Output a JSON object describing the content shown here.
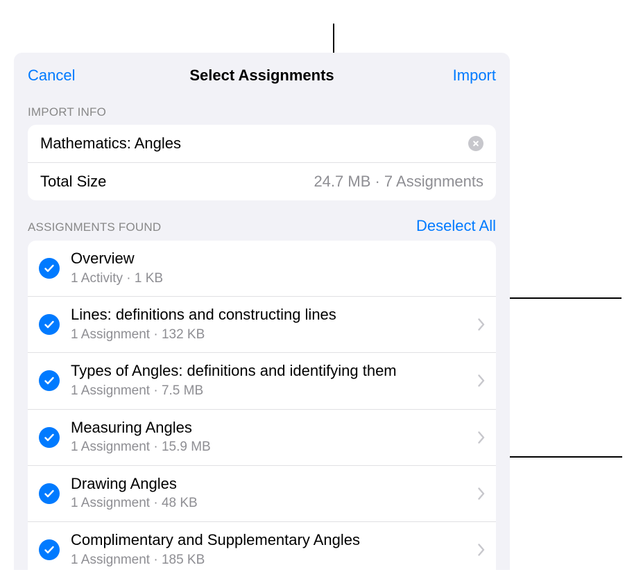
{
  "header": {
    "cancel": "Cancel",
    "title": "Select Assignments",
    "import": "Import"
  },
  "import_info": {
    "section_label": "IMPORT INFO",
    "name": "Mathematics: Angles",
    "total_size_label": "Total Size",
    "total_size_value": "24.7 MB · 7 Assignments"
  },
  "assignments_header": {
    "section_label": "ASSIGNMENTS FOUND",
    "deselect_label": "Deselect All"
  },
  "assignments": [
    {
      "title": "Overview",
      "subtitle": "1 Activity · 1 KB",
      "has_chevron": false
    },
    {
      "title": "Lines: definitions and constructing lines",
      "subtitle": "1 Assignment · 132 KB",
      "has_chevron": true
    },
    {
      "title": "Types of Angles: definitions and identifying them",
      "subtitle": "1 Assignment · 7.5 MB",
      "has_chevron": true
    },
    {
      "title": "Measuring Angles",
      "subtitle": "1 Assignment · 15.9 MB",
      "has_chevron": true
    },
    {
      "title": "Drawing Angles",
      "subtitle": "1 Assignment · 48 KB",
      "has_chevron": true
    },
    {
      "title": "Complimentary and Supplementary Angles",
      "subtitle": "1 Assignment · 185 KB",
      "has_chevron": true
    }
  ]
}
